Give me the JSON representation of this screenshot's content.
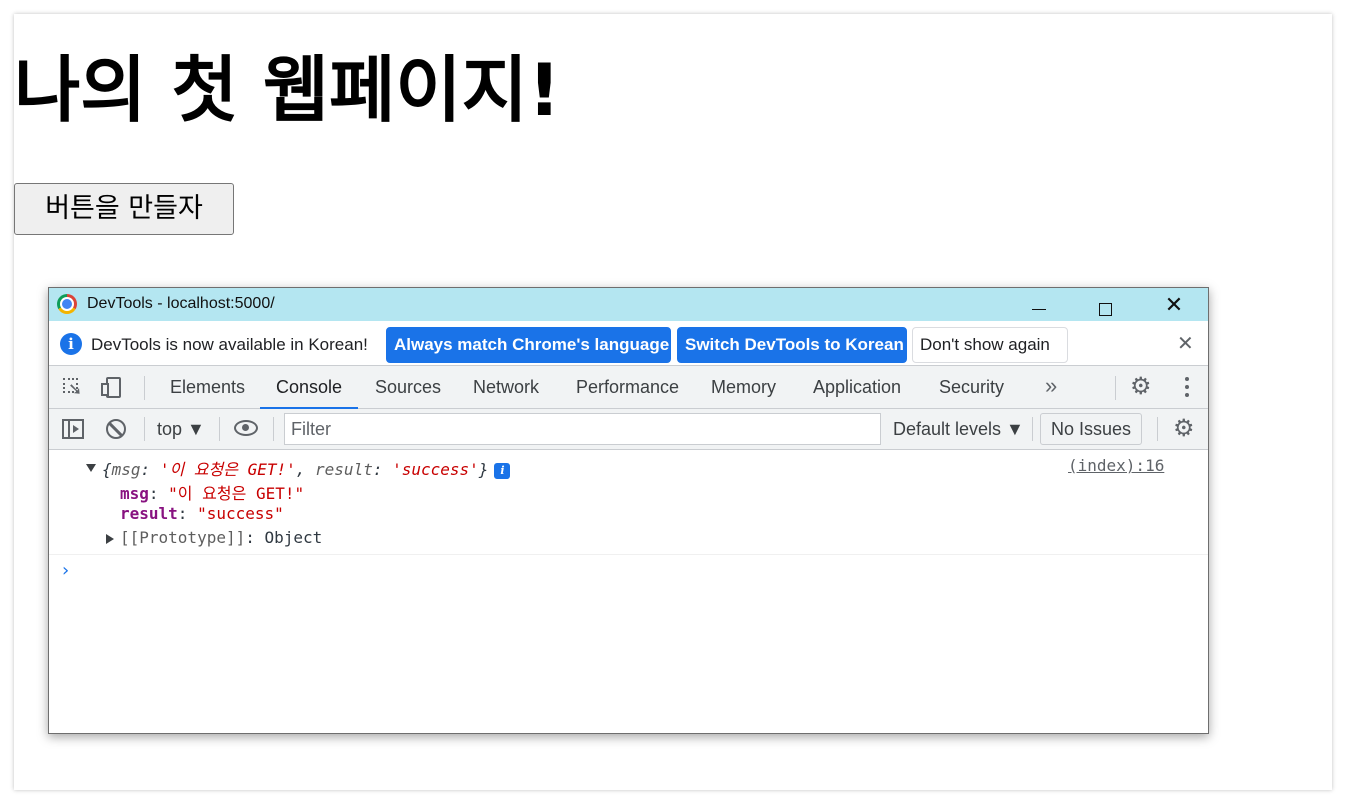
{
  "page": {
    "title": "나의 첫 웹페이지!",
    "button_label": "버튼을 만들자"
  },
  "devtools": {
    "window_title": "DevTools - localhost:5000/",
    "close_glyph": "✕",
    "infobar": {
      "message": "DevTools is now available in Korean!",
      "btn_match": "Always match Chrome's language",
      "btn_switch": "Switch DevTools to Korean",
      "btn_dismiss": "Don't show again",
      "close_glyph": "✕"
    },
    "tabs": [
      {
        "label": "Elements"
      },
      {
        "label": "Console"
      },
      {
        "label": "Sources"
      },
      {
        "label": "Network"
      },
      {
        "label": "Performance"
      },
      {
        "label": "Memory"
      },
      {
        "label": "Application"
      },
      {
        "label": "Security"
      }
    ],
    "more_tabs_glyph": "»",
    "toolbar": {
      "context": "top ▼",
      "filter_placeholder": "Filter",
      "levels": "Default levels ▼",
      "issues": "No Issues"
    },
    "console": {
      "summary": {
        "open": "{",
        "k1": "msg",
        "sep1": ": ",
        "v1": "'이 요청은 GET!'",
        "comma": ", ",
        "k2": "result",
        "sep2": ": ",
        "v2": "'success'",
        "close": "}"
      },
      "info_badge": "i",
      "source_link": "(index):16",
      "props": [
        {
          "key": "msg",
          "value": "\"이 요청은 GET!\""
        },
        {
          "key": "result",
          "value": "\"success\""
        }
      ],
      "prototype_label": "[[Prototype]]",
      "prototype_value": "Object",
      "prompt": "›"
    }
  }
}
